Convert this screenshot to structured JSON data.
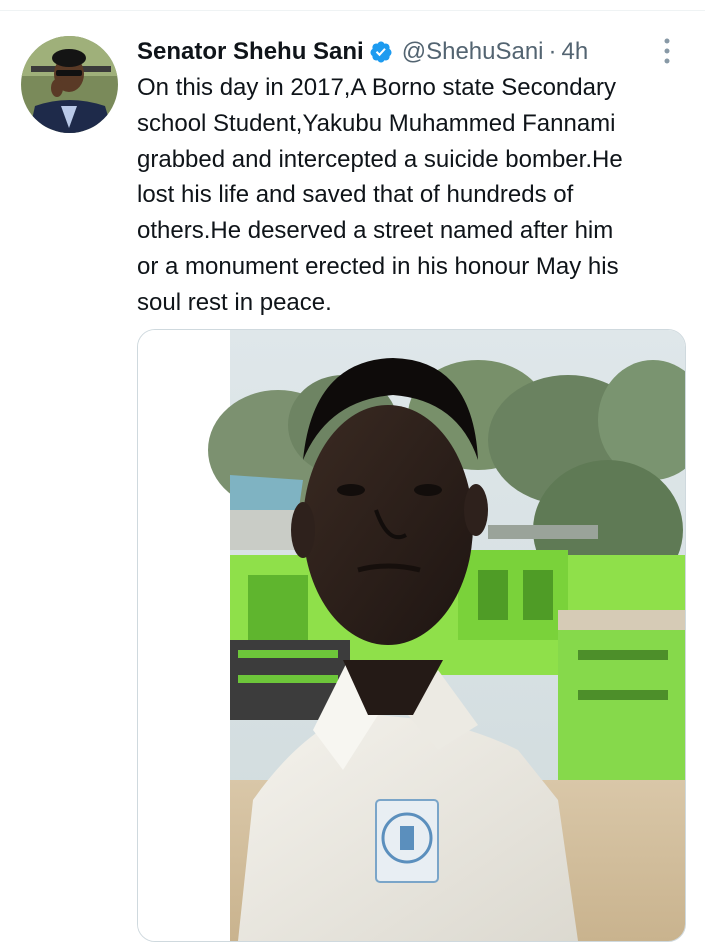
{
  "tweet": {
    "author": {
      "name": "Senator Shehu Sani",
      "handle": "@ShehuSani",
      "verified": true,
      "avatar_icon": "profile-photo"
    },
    "separator": "·",
    "time": "4h",
    "text_lines": [
      "On this day in 2017,A Borno state Secondary",
      "school Student,Yakubu Muhammed Fannami",
      "grabbed and intercepted a suicide bomber.He",
      "lost his life and saved that of hundreds of",
      "others.He deserved a street named after him",
      "or a monument erected in his honour May his",
      "soul rest in peace."
    ],
    "media": {
      "type": "photo"
    }
  },
  "colors": {
    "text_primary": "#0f1419",
    "text_secondary": "#536471",
    "verified_blue": "#1d9bf0",
    "border": "#cfd9de"
  }
}
